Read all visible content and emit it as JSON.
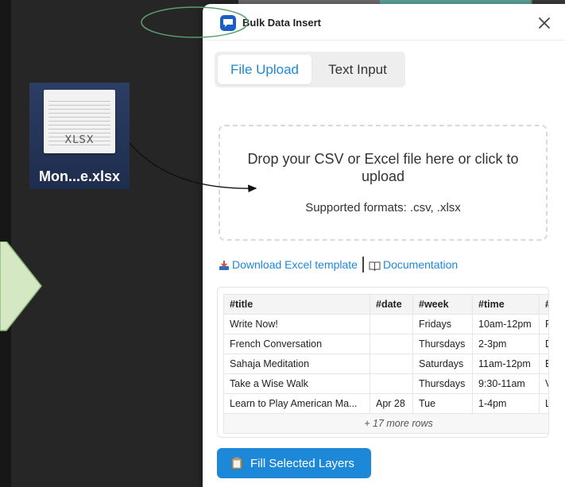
{
  "desktop": {
    "file_icon_ext": "XLSX",
    "file_icon_name": "Mon...e.xlsx"
  },
  "dialog": {
    "title": "Bulk Data Insert",
    "tabs": [
      {
        "label": "File Upload",
        "active": true
      },
      {
        "label": "Text Input",
        "active": false
      }
    ],
    "dropzone": {
      "main_text": "Drop your CSV or Excel file here or click to upload",
      "sub_text": "Supported formats: .csv, .xlsx"
    },
    "links": {
      "template": "Download Excel template",
      "docs": "Documentation"
    },
    "table": {
      "headers": [
        "#title",
        "#date",
        "#week",
        "#time",
        "#"
      ],
      "rows": [
        [
          "Write Now!",
          "",
          "Fridays",
          "10am-12pm",
          "F"
        ],
        [
          "French Conversation",
          "",
          "Thursdays",
          "2-3pm",
          "D"
        ],
        [
          "Sahaja Meditation",
          "",
          "Saturdays",
          "11am-12pm",
          "E"
        ],
        [
          "Take a Wise Walk",
          "",
          "Thursdays",
          "9:30-11am",
          "V"
        ],
        [
          "Learn to Play American Ma...",
          "Apr 28",
          "Tue",
          "1-4pm",
          "L"
        ]
      ],
      "more_rows": "+ 17 more rows"
    },
    "fill_button": "Fill Selected Layers"
  },
  "colors": {
    "accent": "#1e88d8",
    "annotation_green": "#5a9e6e",
    "arrow_fill": "#d5e8c4"
  }
}
